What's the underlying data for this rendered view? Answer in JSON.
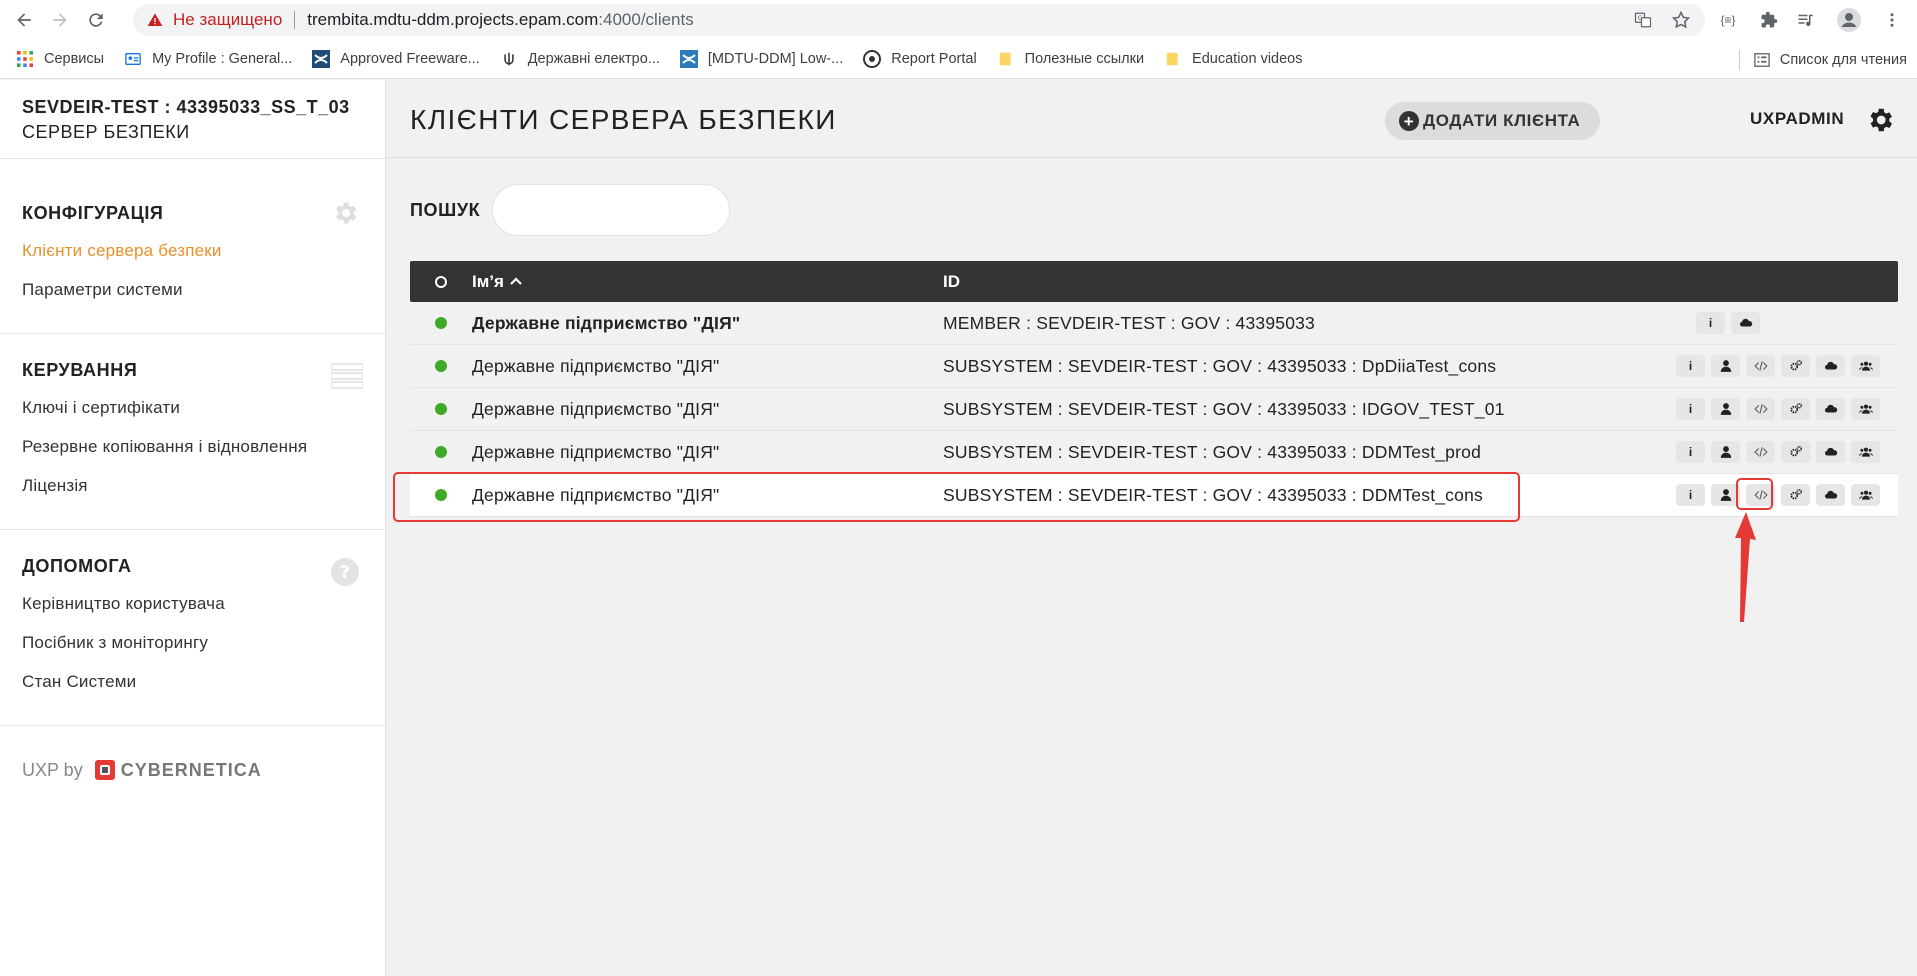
{
  "browser": {
    "security_warning": "Не защищено",
    "url_host": "trembita.mdtu-ddm.projects.epam.com",
    "url_rest": ":4000/clients",
    "bookmarks": [
      {
        "label": "Сервисы",
        "icon": "apps-grid-icon"
      },
      {
        "label": "My Profile : General...",
        "icon": "profile-card-icon"
      },
      {
        "label": "Approved Freeware...",
        "icon": "confluence-icon"
      },
      {
        "label": "Державні електро...",
        "icon": "trident-icon"
      },
      {
        "label": "[MDTU-DDM] Low-...",
        "icon": "confluence-icon"
      },
      {
        "label": "Report Portal",
        "icon": "report-portal-icon"
      },
      {
        "label": "Полезные ссылки",
        "icon": "folder-icon"
      },
      {
        "label": "Education videos",
        "icon": "folder-icon"
      }
    ],
    "reading_list": "Список для чтения"
  },
  "sidebar": {
    "server_id": "SEVDEIR-TEST : 43395033_SS_T_03",
    "server_role": "СЕРВЕР БЕЗПЕКИ",
    "sections": [
      {
        "title": "КОНФІГУРАЦІЯ",
        "icon": "gear-icon",
        "links": [
          "Клієнти сервера безпеки",
          "Параметри системи"
        ]
      },
      {
        "title": "КЕРУВАННЯ",
        "icon": "server-rack-icon",
        "links": [
          "Ключі і сертифікати",
          "Резервне копіювання і відновлення",
          "Ліцензія"
        ]
      },
      {
        "title": "ДОПОМОГА",
        "icon": "help-icon",
        "links": [
          "Керівництво користувача",
          "Посібник з моніторингу",
          "Стан Системи"
        ]
      }
    ],
    "brand_prefix": "UXP by",
    "brand_name": "CYBERNETICA"
  },
  "header": {
    "title": "КЛІЄНТИ СЕРВЕРА БЕЗПЕКИ",
    "add_button": "ДОДАТИ КЛІЄНТА",
    "user": "UXPADMIN"
  },
  "search": {
    "label": "ПОШУК",
    "value": ""
  },
  "table": {
    "columns": [
      "Ім’я",
      "ID"
    ],
    "rows": [
      {
        "name": "Державне підприємство \"ДІЯ\"",
        "id": "MEMBER : SEVDEIR-TEST : GOV : 43395033",
        "status": "green",
        "bold": true
      },
      {
        "name": "Державне підприємство \"ДІЯ\"",
        "id": "SUBSYSTEM : SEVDEIR-TEST : GOV : 43395033 : DpDiiaTest_cons",
        "status": "green"
      },
      {
        "name": "Державне підприємство \"ДІЯ\"",
        "id": "SUBSYSTEM : SEVDEIR-TEST : GOV : 43395033 : IDGOV_TEST_01",
        "status": "green"
      },
      {
        "name": "Державне підприємство \"ДІЯ\"",
        "id": "SUBSYSTEM : SEVDEIR-TEST : GOV : 43395033 : DDMTest_prod",
        "status": "green"
      },
      {
        "name": "Державне підприємство \"ДІЯ\"",
        "id": "SUBSYSTEM : SEVDEIR-TEST : GOV : 43395033 : DDMTest_cons",
        "status": "green",
        "highlighted": true
      }
    ]
  },
  "colors": {
    "accent_orange": "#e8902b",
    "status_green": "#3faa28",
    "annotation_red": "#e53935",
    "table_header": "#333333"
  }
}
